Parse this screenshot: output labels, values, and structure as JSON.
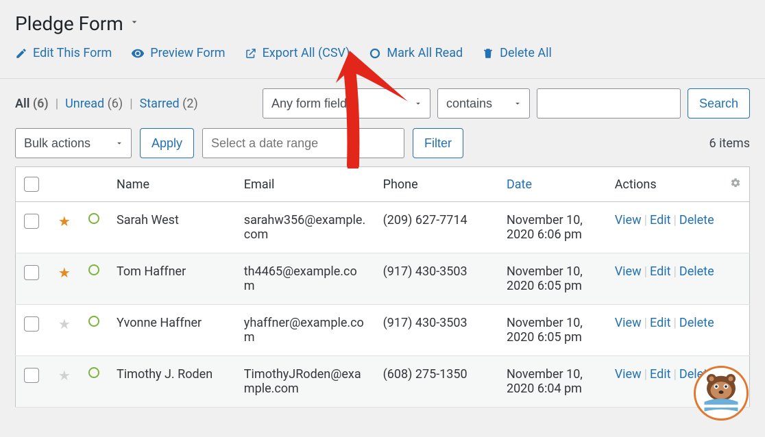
{
  "header": {
    "title": "Pledge Form",
    "edit_form": "Edit This Form",
    "preview_form": "Preview Form",
    "export_csv": "Export All (CSV)",
    "mark_read": "Mark All Read",
    "delete_all": "Delete All"
  },
  "filters": {
    "all_label": "All",
    "all_count": "(6)",
    "unread_label": "Unread",
    "unread_count": "(6)",
    "starred_label": "Starred",
    "starred_count": "(2)",
    "field_select": "Any form field",
    "operator_select": "contains",
    "search_button": "Search",
    "bulk_actions": "Bulk actions",
    "apply_button": "Apply",
    "date_range_placeholder": "Select a date range",
    "filter_button": "Filter",
    "items_count": "6 items"
  },
  "columns": {
    "name": "Name",
    "email": "Email",
    "phone": "Phone",
    "date": "Date",
    "actions": "Actions"
  },
  "row_actions": {
    "view": "View",
    "edit": "Edit",
    "delete": "Delete"
  },
  "rows": [
    {
      "starred": true,
      "name": "Sarah West",
      "email": "sarahw356@example.com",
      "phone": "(209) 627-7714",
      "date": "November 10, 2020 6:06 pm"
    },
    {
      "starred": true,
      "name": "Tom Haffner",
      "email": "th4465@example.com",
      "phone": "(917) 430-3503",
      "date": "November 10, 2020 6:05 pm"
    },
    {
      "starred": false,
      "name": "Yvonne Haffner",
      "email": "yhaffner@example.com",
      "phone": "(917) 430-3503",
      "date": "November 10, 2020 6:05 pm"
    },
    {
      "starred": false,
      "name": "Timothy J. Roden",
      "email": "TimothyJRoden@example.com",
      "phone": "(608) 275-1350",
      "date": "November 10, 2020 6:04 pm"
    }
  ]
}
